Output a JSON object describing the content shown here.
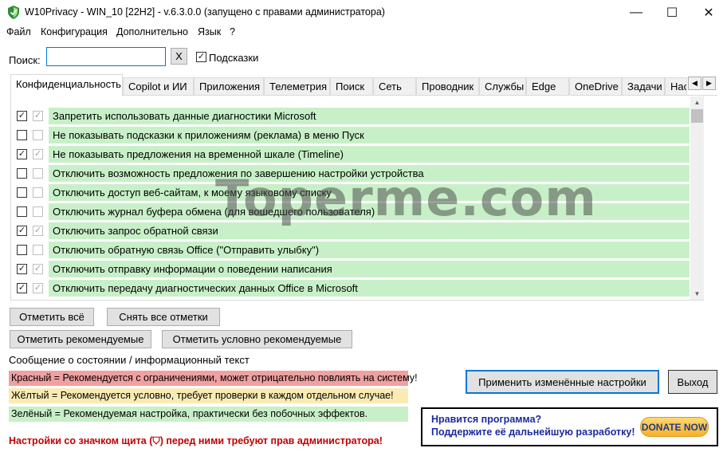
{
  "window": {
    "title": "W10Privacy - WIN_10 [22H2] - v.6.3.0.0 (запущено с правами администратора)",
    "minimize": "—",
    "maximize": "☐",
    "close": "✕"
  },
  "menu": [
    "Файл",
    "Конфигурация",
    "Дополнительно",
    "Язык",
    "?"
  ],
  "search": {
    "label": "Поиск:",
    "value": "",
    "placeholder": "",
    "clear_label": "X",
    "hints_label": "Подсказки",
    "hints_checked": true
  },
  "tabs": [
    "Конфиденциальность",
    "Copilot и ИИ",
    "Приложения",
    "Телеметрия",
    "Поиск",
    "Сеть",
    "Проводник",
    "Службы",
    "Edge",
    "OneDrive",
    "Задачи",
    "Нас"
  ],
  "active_tab": 0,
  "settings": [
    {
      "label": "Запретить использовать данные диагностики Microsoft",
      "checked": true,
      "recommended_checked": true,
      "color": "green"
    },
    {
      "label": "Не показывать подсказки к приложениям (реклама) в меню Пуск",
      "checked": false,
      "recommended_checked": false,
      "color": "green"
    },
    {
      "label": "Не показывать предложения на временной шкале (Timeline)",
      "checked": true,
      "recommended_checked": true,
      "color": "green"
    },
    {
      "label": "Отключить возможность предложения по завершению настройки устройства",
      "checked": false,
      "recommended_checked": false,
      "color": "green"
    },
    {
      "label": "Отключить доступ веб-сайтам, к моему языковому списку",
      "checked": false,
      "recommended_checked": false,
      "color": "green"
    },
    {
      "label": "Отключить журнал буфера обмена (для вошедшего пользователя)",
      "checked": false,
      "recommended_checked": false,
      "color": "green"
    },
    {
      "label": "Отключить запрос обратной связи",
      "checked": true,
      "recommended_checked": true,
      "color": "green"
    },
    {
      "label": "Отключить обратную связь Office (\"Отправить улыбку\")",
      "checked": false,
      "recommended_checked": false,
      "color": "green"
    },
    {
      "label": "Отключить отправку информации о поведении написания",
      "checked": true,
      "recommended_checked": true,
      "color": "green"
    },
    {
      "label": "Отключить передачу диагностических данных Office в Microsoft",
      "checked": true,
      "recommended_checked": true,
      "color": "green"
    }
  ],
  "buttons": {
    "check_all": "Отметить всё",
    "uncheck_all": "Снять все отметки",
    "check_recommended": "Отметить рекомендуемые",
    "check_conditional": "Отметить условно рекомендуемые",
    "apply": "Применить изменённые настройки",
    "exit": "Выход"
  },
  "status": {
    "caption": "Сообщение о состоянии / информационный текст",
    "legend_red": "Красный = Рекомендуется с ограничениями, может отрицательно повлиять на систему!",
    "legend_yellow": "Жёлтый = Рекомендуется условно, требует проверки в каждом отдельном случае!",
    "legend_green": "Зелёный = Рекомендуемая настройка, практически без побочных эффектов.",
    "admin_note": "Настройки со значком щита (⛉) перед ними требуют прав администратора!"
  },
  "donate": {
    "line1": "Нравится программа?",
    "line2": "Поддержите её дальнейшую разработку!",
    "button": "DONATE NOW"
  },
  "watermark": "Toperme.com",
  "colors": {
    "green": "#c8f0c8",
    "red": "#f0a0a0",
    "yellow": "#faebb4",
    "accent": "#0078d7"
  }
}
